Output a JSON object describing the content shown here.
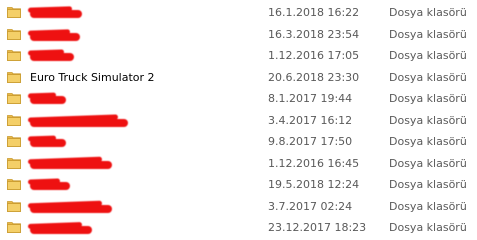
{
  "files": [
    {
      "name": "",
      "redacted": true,
      "date": "16.1.2018 16:22",
      "type": "Dosya klasörü"
    },
    {
      "name": "",
      "redacted": true,
      "date": "16.3.2018 23:54",
      "type": "Dosya klasörü"
    },
    {
      "name": "",
      "redacted": true,
      "date": "1.12.2016 17:05",
      "type": "Dosya klasörü"
    },
    {
      "name": "Euro Truck Simulator 2",
      "redacted": false,
      "date": "20.6.2018 23:30",
      "type": "Dosya klasörü"
    },
    {
      "name": "",
      "redacted": true,
      "date": "8.1.2017 19:44",
      "type": "Dosya klasörü"
    },
    {
      "name": "",
      "redacted": true,
      "date": "3.4.2017 16:12",
      "type": "Dosya klasörü"
    },
    {
      "name": "",
      "redacted": true,
      "date": "9.8.2017 17:50",
      "type": "Dosya klasörü"
    },
    {
      "name": "",
      "redacted": true,
      "date": "1.12.2016 16:45",
      "type": "Dosya klasörü"
    },
    {
      "name": "",
      "redacted": true,
      "date": "19.5.2018 12:24",
      "type": "Dosya klasörü"
    },
    {
      "name": "",
      "redacted": true,
      "date": "3.7.2017 02:24",
      "type": "Dosya klasörü"
    },
    {
      "name": "",
      "redacted": true,
      "date": "23.12.2017 18:23",
      "type": "Dosya klasörü"
    }
  ],
  "icon": "folder-icon",
  "colors": {
    "redaction": "#ee1111",
    "folder": "#e8b84a",
    "meta_text": "#5a5a5a"
  }
}
